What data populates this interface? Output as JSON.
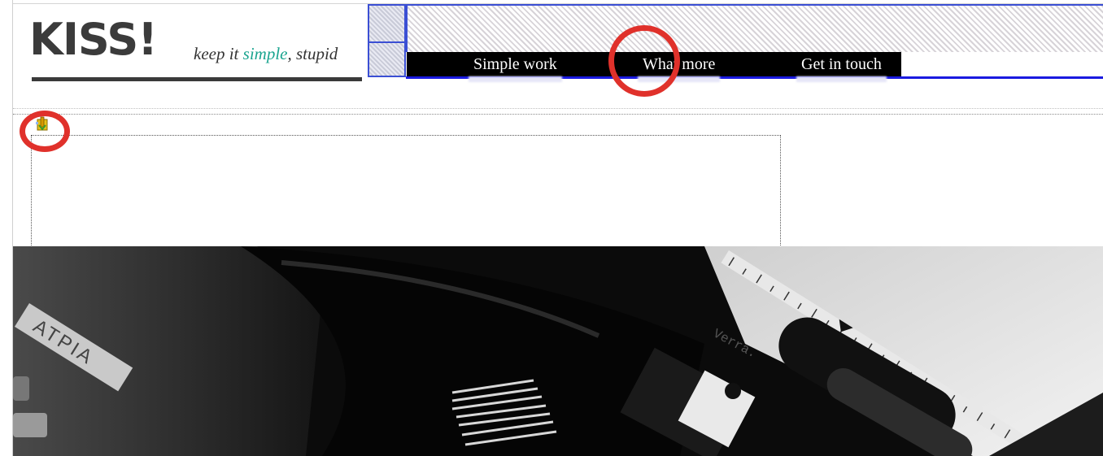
{
  "header": {
    "logo": "KISS!",
    "tagline_before": "keep it ",
    "tagline_accent": "simple",
    "tagline_after": ", stupid"
  },
  "nav": {
    "items": [
      {
        "label": "Simple work"
      },
      {
        "label": "What more"
      },
      {
        "label": "Get in touch"
      }
    ]
  },
  "hero": {
    "type_label": "ATPIA",
    "paper_text": "Verra."
  },
  "colors": {
    "accent": "#1aa48f",
    "annotation": "#e0312b",
    "guide": "#3b4fd4",
    "nav_bg": "#000000"
  },
  "icons": {
    "anchor": "anchor-marker-icon"
  }
}
